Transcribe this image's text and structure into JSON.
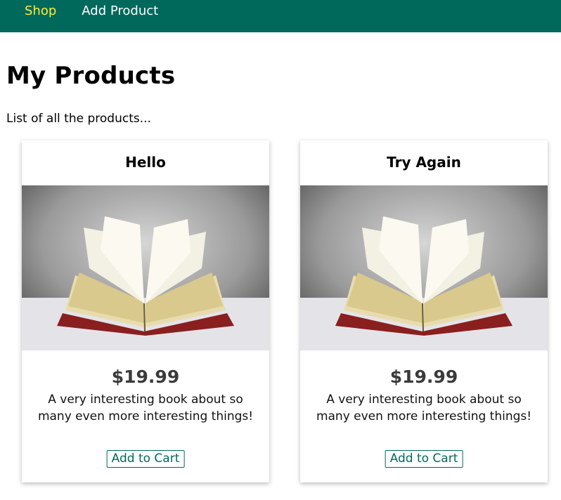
{
  "nav": {
    "items": [
      {
        "label": "Shop",
        "active": true
      },
      {
        "label": "Add Product",
        "active": false
      }
    ]
  },
  "page": {
    "title": "My Products",
    "subtitle": "List of all the products..."
  },
  "products": [
    {
      "title": "Hello",
      "image_icon": "open-book",
      "price": "$19.99",
      "description": "A very interesting book about so many even more interesting things!",
      "button": "Add to Cart"
    },
    {
      "title": "Try Again",
      "image_icon": "open-book",
      "price": "$19.99",
      "description": "A very interesting book about so many even more interesting things!",
      "button": "Add to Cart"
    }
  ],
  "colors": {
    "header": "#00695c",
    "nav_active": "#ffeb3b",
    "button": "#00695c"
  }
}
